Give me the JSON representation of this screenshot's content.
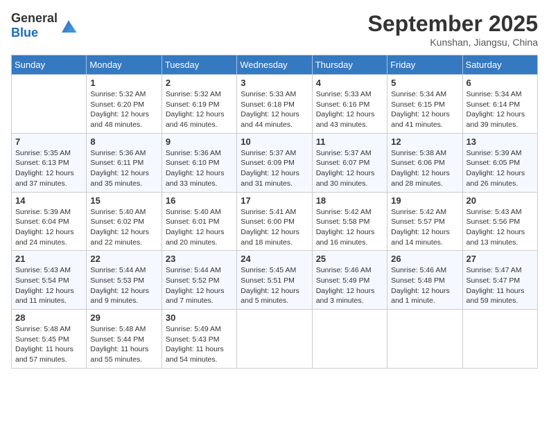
{
  "header": {
    "logo": {
      "text_general": "General",
      "text_blue": "Blue"
    },
    "month": "September 2025",
    "location": "Kunshan, Jiangsu, China"
  },
  "days_of_week": [
    "Sunday",
    "Monday",
    "Tuesday",
    "Wednesday",
    "Thursday",
    "Friday",
    "Saturday"
  ],
  "weeks": [
    [
      {
        "day": "",
        "info": ""
      },
      {
        "day": "1",
        "info": "Sunrise: 5:32 AM\nSunset: 6:20 PM\nDaylight: 12 hours\nand 48 minutes."
      },
      {
        "day": "2",
        "info": "Sunrise: 5:32 AM\nSunset: 6:19 PM\nDaylight: 12 hours\nand 46 minutes."
      },
      {
        "day": "3",
        "info": "Sunrise: 5:33 AM\nSunset: 6:18 PM\nDaylight: 12 hours\nand 44 minutes."
      },
      {
        "day": "4",
        "info": "Sunrise: 5:33 AM\nSunset: 6:16 PM\nDaylight: 12 hours\nand 43 minutes."
      },
      {
        "day": "5",
        "info": "Sunrise: 5:34 AM\nSunset: 6:15 PM\nDaylight: 12 hours\nand 41 minutes."
      },
      {
        "day": "6",
        "info": "Sunrise: 5:34 AM\nSunset: 6:14 PM\nDaylight: 12 hours\nand 39 minutes."
      }
    ],
    [
      {
        "day": "7",
        "info": "Sunrise: 5:35 AM\nSunset: 6:13 PM\nDaylight: 12 hours\nand 37 minutes."
      },
      {
        "day": "8",
        "info": "Sunrise: 5:36 AM\nSunset: 6:11 PM\nDaylight: 12 hours\nand 35 minutes."
      },
      {
        "day": "9",
        "info": "Sunrise: 5:36 AM\nSunset: 6:10 PM\nDaylight: 12 hours\nand 33 minutes."
      },
      {
        "day": "10",
        "info": "Sunrise: 5:37 AM\nSunset: 6:09 PM\nDaylight: 12 hours\nand 31 minutes."
      },
      {
        "day": "11",
        "info": "Sunrise: 5:37 AM\nSunset: 6:07 PM\nDaylight: 12 hours\nand 30 minutes."
      },
      {
        "day": "12",
        "info": "Sunrise: 5:38 AM\nSunset: 6:06 PM\nDaylight: 12 hours\nand 28 minutes."
      },
      {
        "day": "13",
        "info": "Sunrise: 5:39 AM\nSunset: 6:05 PM\nDaylight: 12 hours\nand 26 minutes."
      }
    ],
    [
      {
        "day": "14",
        "info": "Sunrise: 5:39 AM\nSunset: 6:04 PM\nDaylight: 12 hours\nand 24 minutes."
      },
      {
        "day": "15",
        "info": "Sunrise: 5:40 AM\nSunset: 6:02 PM\nDaylight: 12 hours\nand 22 minutes."
      },
      {
        "day": "16",
        "info": "Sunrise: 5:40 AM\nSunset: 6:01 PM\nDaylight: 12 hours\nand 20 minutes."
      },
      {
        "day": "17",
        "info": "Sunrise: 5:41 AM\nSunset: 6:00 PM\nDaylight: 12 hours\nand 18 minutes."
      },
      {
        "day": "18",
        "info": "Sunrise: 5:42 AM\nSunset: 5:58 PM\nDaylight: 12 hours\nand 16 minutes."
      },
      {
        "day": "19",
        "info": "Sunrise: 5:42 AM\nSunset: 5:57 PM\nDaylight: 12 hours\nand 14 minutes."
      },
      {
        "day": "20",
        "info": "Sunrise: 5:43 AM\nSunset: 5:56 PM\nDaylight: 12 hours\nand 13 minutes."
      }
    ],
    [
      {
        "day": "21",
        "info": "Sunrise: 5:43 AM\nSunset: 5:54 PM\nDaylight: 12 hours\nand 11 minutes."
      },
      {
        "day": "22",
        "info": "Sunrise: 5:44 AM\nSunset: 5:53 PM\nDaylight: 12 hours\nand 9 minutes."
      },
      {
        "day": "23",
        "info": "Sunrise: 5:44 AM\nSunset: 5:52 PM\nDaylight: 12 hours\nand 7 minutes."
      },
      {
        "day": "24",
        "info": "Sunrise: 5:45 AM\nSunset: 5:51 PM\nDaylight: 12 hours\nand 5 minutes."
      },
      {
        "day": "25",
        "info": "Sunrise: 5:46 AM\nSunset: 5:49 PM\nDaylight: 12 hours\nand 3 minutes."
      },
      {
        "day": "26",
        "info": "Sunrise: 5:46 AM\nSunset: 5:48 PM\nDaylight: 12 hours\nand 1 minute."
      },
      {
        "day": "27",
        "info": "Sunrise: 5:47 AM\nSunset: 5:47 PM\nDaylight: 11 hours\nand 59 minutes."
      }
    ],
    [
      {
        "day": "28",
        "info": "Sunrise: 5:48 AM\nSunset: 5:45 PM\nDaylight: 11 hours\nand 57 minutes."
      },
      {
        "day": "29",
        "info": "Sunrise: 5:48 AM\nSunset: 5:44 PM\nDaylight: 11 hours\nand 55 minutes."
      },
      {
        "day": "30",
        "info": "Sunrise: 5:49 AM\nSunset: 5:43 PM\nDaylight: 11 hours\nand 54 minutes."
      },
      {
        "day": "",
        "info": ""
      },
      {
        "day": "",
        "info": ""
      },
      {
        "day": "",
        "info": ""
      },
      {
        "day": "",
        "info": ""
      }
    ]
  ]
}
